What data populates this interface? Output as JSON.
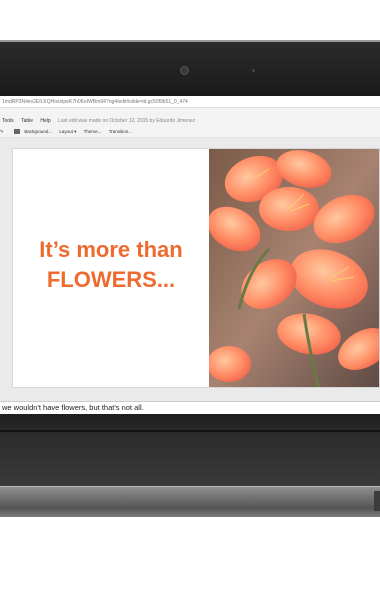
{
  "browser": {
    "url": "1mdRP3N4ev2EfLKQHossIpeK7h0KeIWBm947ng4/edit#slide=id.gc50f9b51_0_474"
  },
  "menu": {
    "items": [
      "Tools",
      "Table",
      "Help"
    ],
    "last_edit": "Last edit was made on October 12, 2015 by Eduardo Jimenez"
  },
  "toolbar": {
    "background": "Background...",
    "layout": "Layout ▾",
    "theme": "Theme...",
    "transition": "Transition..."
  },
  "slide": {
    "line1": "It’s more than",
    "line2": "FLOWERS...",
    "text_color": "#ee6b2f"
  },
  "speaker_notes": {
    "text": "we wouldn't have flowers, but that's not all."
  }
}
